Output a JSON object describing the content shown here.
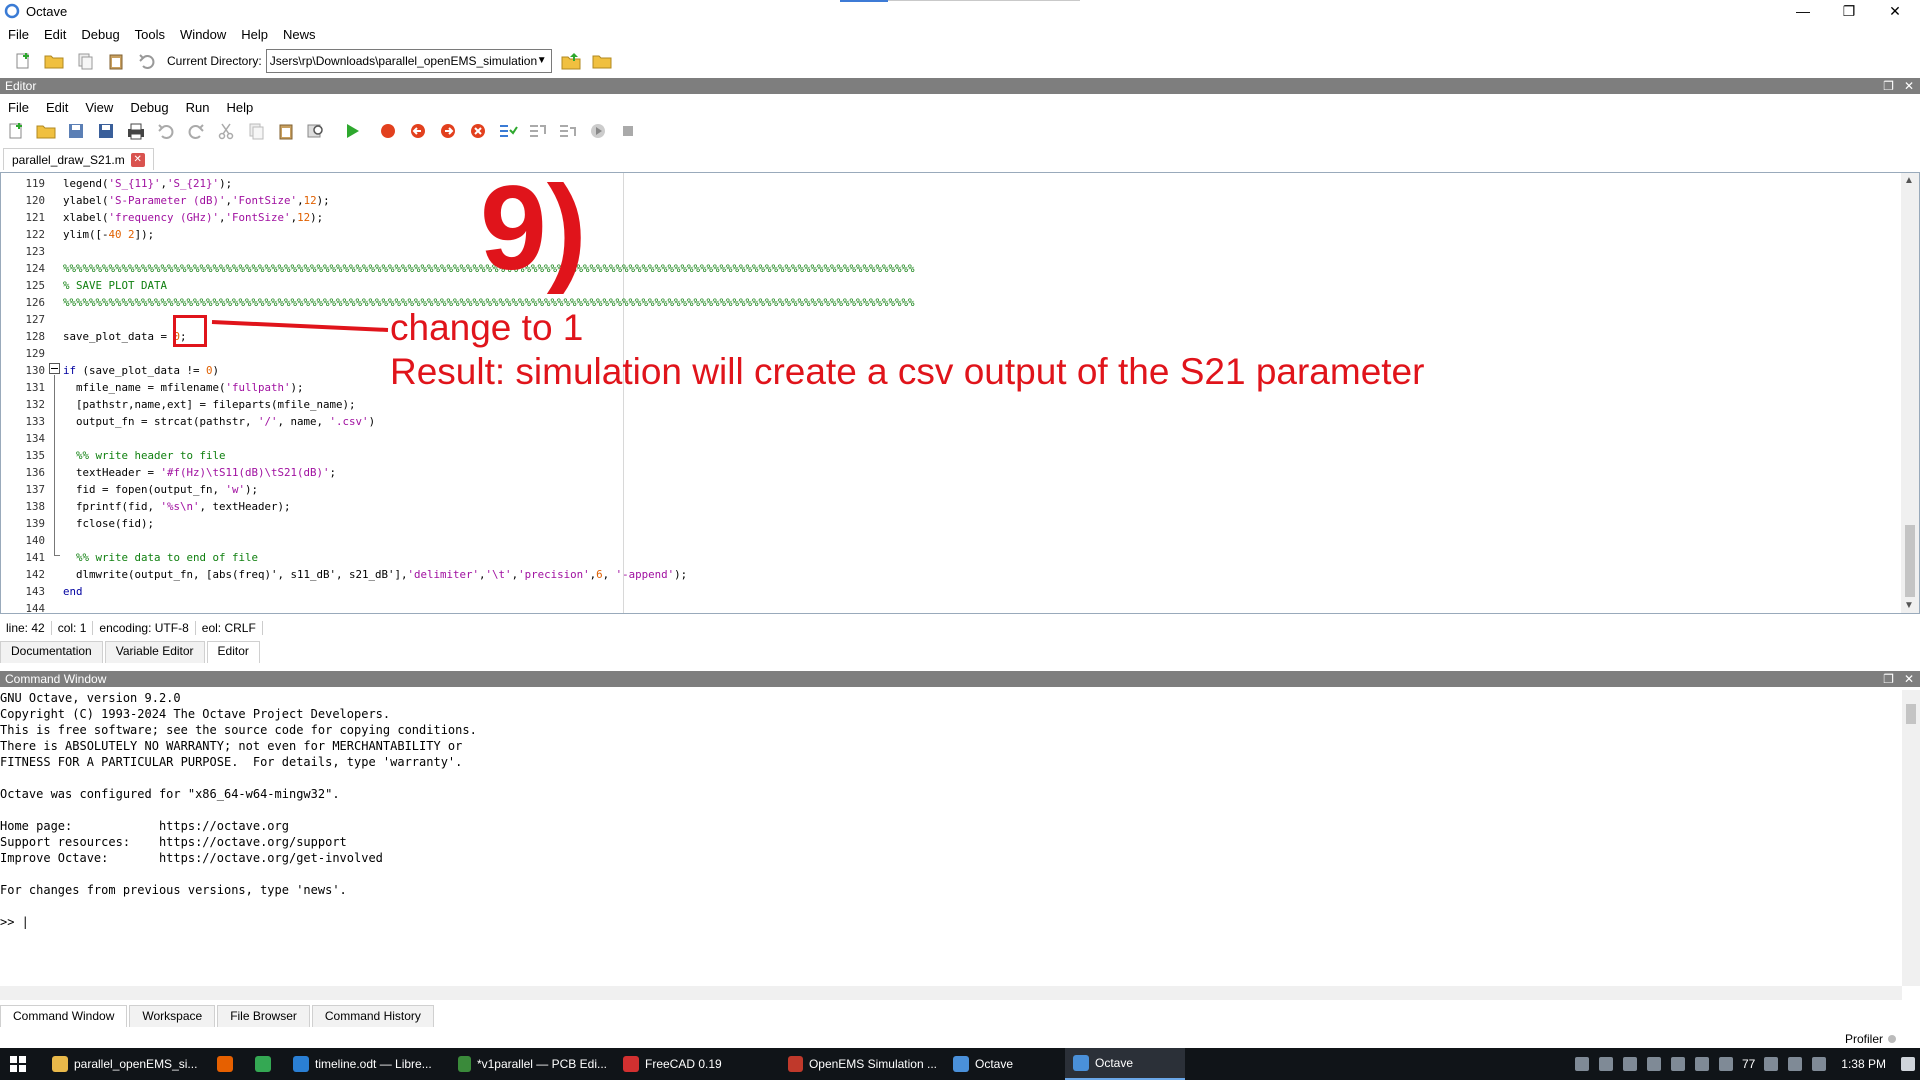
{
  "window": {
    "title": "Octave"
  },
  "menu": [
    "File",
    "Edit",
    "Debug",
    "Tools",
    "Window",
    "Help",
    "News"
  ],
  "current_directory": {
    "label": "Current Directory:",
    "value": "Jsers\\rp\\Downloads\\parallel_openEMS_simulation"
  },
  "editor_panel": {
    "title": "Editor"
  },
  "editor_menu": [
    "File",
    "Edit",
    "View",
    "Debug",
    "Run",
    "Help"
  ],
  "file_tab": {
    "name": "parallel_draw_S21.m"
  },
  "annotation": {
    "step": "9)",
    "line1": "change to 1",
    "line2": "Result: simulation will create a csv output of the S21 parameter"
  },
  "code_lines": [
    {
      "n": "119",
      "html": "legend(<span class='str'>'S_{11}'</span>,<span class='str'>'S_{21}'</span>);"
    },
    {
      "n": "120",
      "html": "ylabel(<span class='str'>'S-Parameter (dB)'</span>,<span class='str'>'FontSize'</span>,<span class='num'>12</span>);"
    },
    {
      "n": "121",
      "html": "xlabel(<span class='str'>'frequency (GHz)'</span>,<span class='str'>'FontSize'</span>,<span class='num'>12</span>);"
    },
    {
      "n": "122",
      "html": "ylim([-<span class='num'>40</span> <span class='num'>2</span>]);"
    },
    {
      "n": "123",
      "html": ""
    },
    {
      "n": "124",
      "html": "<span class='cmt'>%%%%%%%%%%%%%%%%%%%%%%%%%%%%%%%%%%%%%%%%%%%%%%%%%%%%%%%%%%%%%%%%%%%%%%%%%%%%%%%%%%%%%%%%%%%%%%%%%%%%%%%%%%%%%%%%%%%%%%%%%%%%%%%%%%%</span>"
    },
    {
      "n": "125",
      "html": "<span class='cmt'>% SAVE PLOT DATA</span>"
    },
    {
      "n": "126",
      "html": "<span class='cmt'>%%%%%%%%%%%%%%%%%%%%%%%%%%%%%%%%%%%%%%%%%%%%%%%%%%%%%%%%%%%%%%%%%%%%%%%%%%%%%%%%%%%%%%%%%%%%%%%%%%%%%%%%%%%%%%%%%%%%%%%%%%%%%%%%%%%</span>"
    },
    {
      "n": "127",
      "html": ""
    },
    {
      "n": "128",
      "html": "save_plot_data = <span class='num'>0</span>;"
    },
    {
      "n": "129",
      "html": ""
    },
    {
      "n": "130",
      "html": "<span class='kw'>if</span> (save_plot_data != <span class='num'>0</span>)"
    },
    {
      "n": "131",
      "html": "  mfile_name = mfilename(<span class='str'>'fullpath'</span>);"
    },
    {
      "n": "132",
      "html": "  [pathstr,name,ext] = fileparts(mfile_name);"
    },
    {
      "n": "133",
      "html": "  output_fn = strcat(pathstr, <span class='str'>'/'</span>, name, <span class='str'>'.csv'</span>)"
    },
    {
      "n": "134",
      "html": ""
    },
    {
      "n": "135",
      "html": "  <span class='cmt'>%% write header to file</span>"
    },
    {
      "n": "136",
      "html": "  textHeader = <span class='str'>'#f(Hz)\\tS11(dB)\\tS21(dB)'</span>;"
    },
    {
      "n": "137",
      "html": "  fid = fopen(output_fn, <span class='str'>'w'</span>);"
    },
    {
      "n": "138",
      "html": "  fprintf(fid, <span class='str'>'%s\\n'</span>, textHeader);"
    },
    {
      "n": "139",
      "html": "  fclose(fid);"
    },
    {
      "n": "140",
      "html": ""
    },
    {
      "n": "141",
      "html": "  <span class='cmt'>%% write data to end of file</span>"
    },
    {
      "n": "142",
      "html": "  dlmwrite(output_fn, [abs(freq)', s11_dB', s21_dB'],<span class='str'>'delimiter'</span>,<span class='str'>'\\t'</span>,<span class='str'>'precision'</span>,<span class='num'>6</span>, <span class='str'>'-append'</span>);"
    },
    {
      "n": "143",
      "html": "<span class='kw'>end</span>"
    },
    {
      "n": "144",
      "html": ""
    }
  ],
  "status": {
    "line": "line: 42",
    "col": "col: 1",
    "encoding": "encoding: UTF-8",
    "eol": "eol: CRLF"
  },
  "bottom_tabs": [
    "Documentation",
    "Variable Editor",
    "Editor"
  ],
  "command_window": {
    "title": "Command Window",
    "lines": [
      "GNU Octave, version 9.2.0",
      "Copyright (C) 1993-2024 The Octave Project Developers.",
      "This is free software; see the source code for copying conditions.",
      "There is ABSOLUTELY NO WARRANTY; not even for MERCHANTABILITY or",
      "FITNESS FOR A PARTICULAR PURPOSE.  For details, type 'warranty'.",
      "",
      "Octave was configured for \"x86_64-w64-mingw32\".",
      "",
      "Home page:            https://octave.org",
      "Support resources:    https://octave.org/support",
      "Improve Octave:       https://octave.org/get-involved",
      "",
      "For changes from previous versions, type 'news'.",
      "",
      ">> |"
    ]
  },
  "dock_tabs": [
    "Command Window",
    "Workspace",
    "File Browser",
    "Command History"
  ],
  "profiler": "Profiler",
  "taskbar": {
    "items": [
      {
        "label": "parallel_openEMS_si...",
        "color": "#e8b84a"
      },
      {
        "label": "",
        "color": "#e66000"
      },
      {
        "label": "",
        "color": "#34a853"
      },
      {
        "label": "timeline.odt — Libre...",
        "color": "#2a7fd4"
      },
      {
        "label": "*v1parallel — PCB Edi...",
        "color": "#3a8a3a"
      },
      {
        "label": "FreeCAD 0.19",
        "color": "#d23030"
      },
      {
        "label": "OpenEMS Simulation ...",
        "color": "#c0392b"
      },
      {
        "label": "Octave",
        "color": "#4a90d9"
      },
      {
        "label": "Octave",
        "color": "#4a90d9"
      }
    ],
    "tray_number": "77",
    "time": "1:38 PM"
  }
}
